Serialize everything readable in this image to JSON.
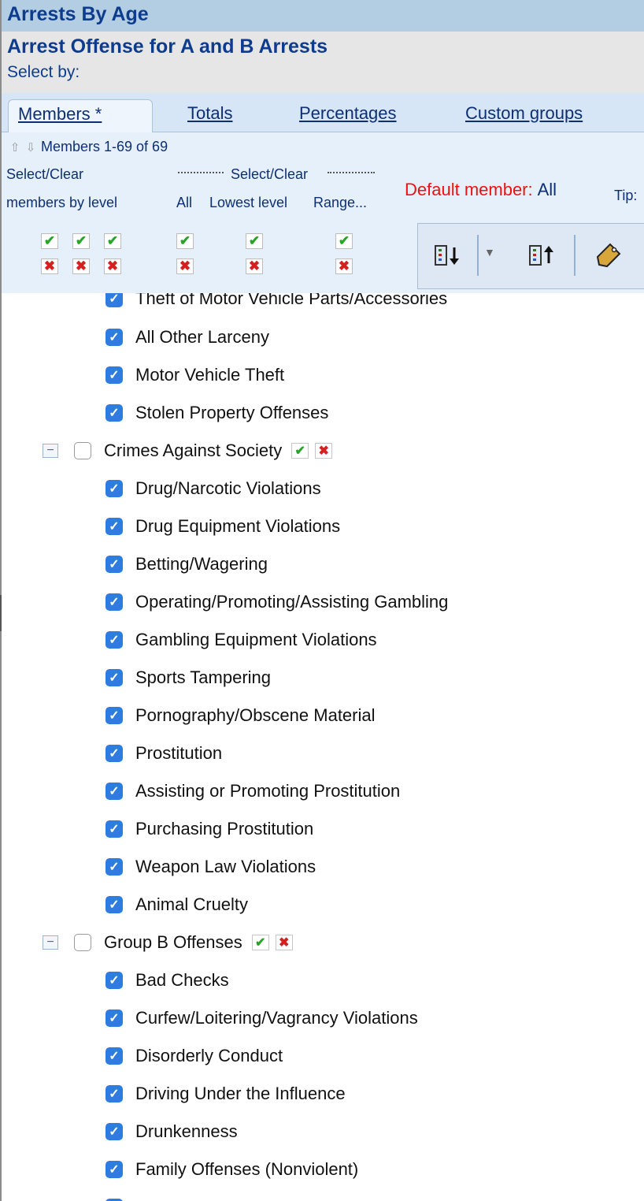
{
  "header": {
    "title": "Arrests By Age",
    "subtitle": "Arrest Offense for A and B Arrests",
    "select_by": "Select by:"
  },
  "tabs": [
    {
      "label": "Members *",
      "active": true
    },
    {
      "label": "Totals",
      "active": false
    },
    {
      "label": "Percentages",
      "active": false
    },
    {
      "label": "Custom groups",
      "active": false
    }
  ],
  "controls": {
    "members_range": "Members 1-69 of 69",
    "select_clear_level_line1": "Select/Clear",
    "select_clear_level_line2": "members by level",
    "select_clear_center": "Select/Clear",
    "all_label": "All",
    "lowest_level_label": "Lowest level",
    "range_label": "Range...",
    "default_member_label": "Default member:",
    "default_member_value": "All",
    "tip_label": "Tip:"
  },
  "tree": {
    "cutoff_item": "Theft of Motor Vehicle Parts/Accessories",
    "items_before": [
      "All Other Larceny",
      "Motor Vehicle Theft",
      "Stolen Property Offenses"
    ],
    "group1": {
      "label": "Crimes Against Society",
      "items": [
        "Drug/Narcotic Violations",
        "Drug Equipment Violations",
        "Betting/Wagering",
        "Operating/Promoting/Assisting Gambling",
        "Gambling Equipment Violations",
        "Sports Tampering",
        "Pornography/Obscene Material",
        "Prostitution",
        "Assisting or Promoting Prostitution",
        "Purchasing Prostitution",
        "Weapon Law Violations",
        "Animal Cruelty"
      ]
    },
    "group2": {
      "label": "Group B Offenses",
      "items": [
        "Bad Checks",
        "Curfew/Loitering/Vagrancy Violations",
        "Disorderly Conduct",
        "Driving Under the Influence",
        "Drunkenness",
        "Family Offenses (Nonviolent)"
      ]
    }
  }
}
